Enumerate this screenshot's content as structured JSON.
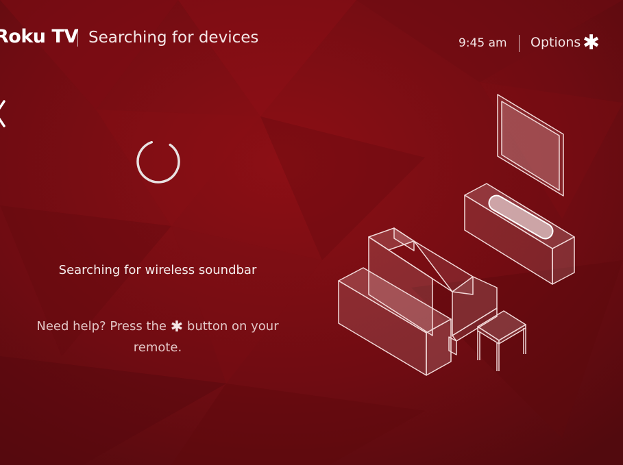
{
  "header": {
    "logo": "Roku TV",
    "title": "Searching for devices",
    "time": "9:45 am",
    "options_label": "Options"
  },
  "icons": {
    "back": "back-arrow-icon",
    "options": "asterisk-icon",
    "spinner": "loading-spinner-icon",
    "illustration": "living-room-soundbar-illustration"
  },
  "main": {
    "status": "Searching for wireless soundbar",
    "help_before": "Need help? Press the",
    "help_after": "button on your remote."
  },
  "colors": {
    "background": "#7a0d12",
    "text": "#ffffff",
    "muted_text": "#e3c6c6"
  }
}
